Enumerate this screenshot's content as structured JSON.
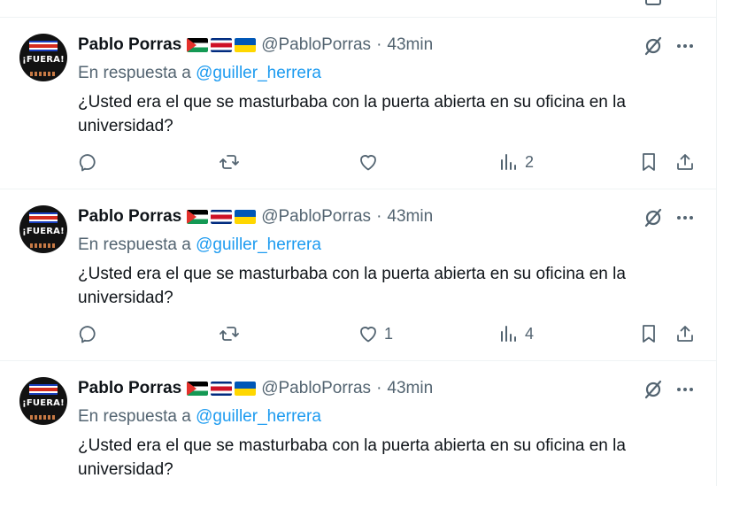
{
  "colors": {
    "text_primary": "#0f1419",
    "text_secondary": "#536471",
    "link": "#1d9bf0",
    "divider": "#eff3f4"
  },
  "avatar_label": "¡FUERA!",
  "tweets": [
    {
      "author_name": "Pablo Porras",
      "flags": [
        "palestine-flag-icon",
        "costa-rica-flag-icon",
        "ukraine-flag-icon"
      ],
      "handle": "@PabloPorras",
      "separator": "·",
      "time": "43min",
      "reply_prefix": "En respuesta a",
      "reply_to": "@guiller_herrera",
      "text": "¿Usted era el que se masturbaba con la puerta abierta en su oficina en la universidad?",
      "likes": "",
      "views": "2"
    },
    {
      "author_name": "Pablo Porras",
      "flags": [
        "palestine-flag-icon",
        "costa-rica-flag-icon",
        "ukraine-flag-icon"
      ],
      "handle": "@PabloPorras",
      "separator": "·",
      "time": "43min",
      "reply_prefix": "En respuesta a",
      "reply_to": "@guiller_herrera",
      "text": "¿Usted era el que se masturbaba con la puerta abierta en su oficina en la universidad?",
      "likes": "1",
      "views": "4"
    },
    {
      "author_name": "Pablo Porras",
      "flags": [
        "palestine-flag-icon",
        "costa-rica-flag-icon",
        "ukraine-flag-icon"
      ],
      "handle": "@PabloPorras",
      "separator": "·",
      "time": "43min",
      "reply_prefix": "En respuesta a",
      "reply_to": "@guiller_herrera",
      "text": "¿Usted era el que se masturbaba con la puerta abierta en su oficina en la universidad?"
    }
  ]
}
